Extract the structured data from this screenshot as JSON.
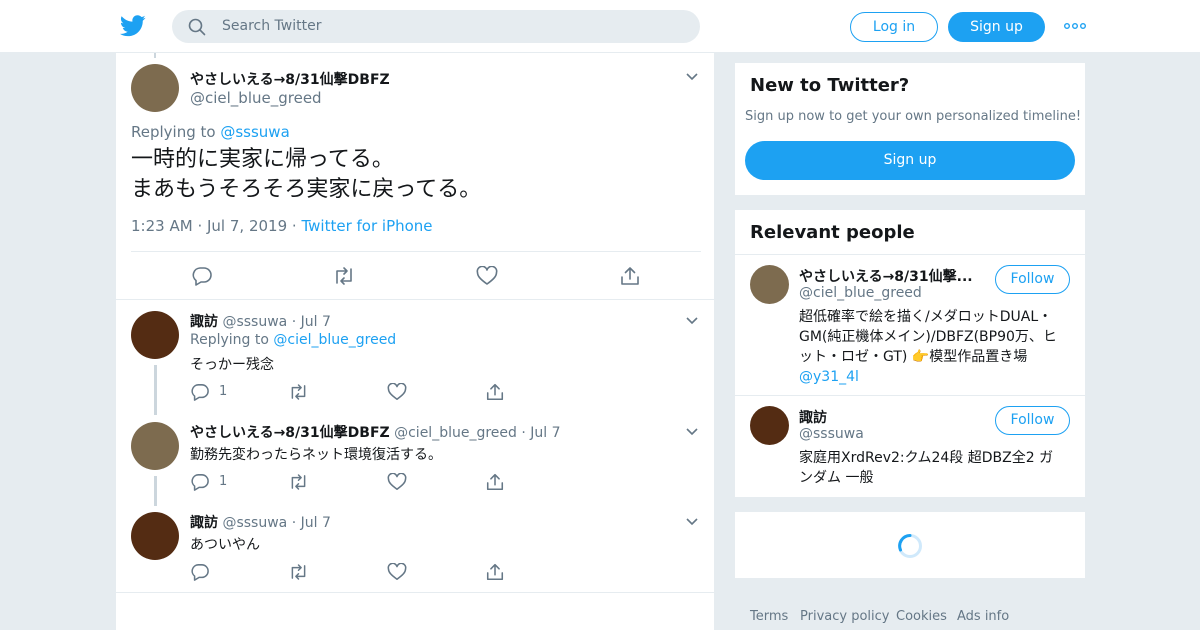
{
  "header": {
    "search_placeholder": "Search Twitter",
    "login_label": "Log in",
    "signup_label": "Sign up"
  },
  "main_tweet": {
    "name": "やさしいえる→8/31仙撃DBFZ",
    "handle": "@ciel_blue_greed",
    "replying_prefix": "Replying to",
    "replying_to": "@sssuwa",
    "text_line1": "一時的に実家に帰ってる。",
    "text_line2": "まあもうそろそろ実家に戻ってる。",
    "time": "1:23 AM",
    "date": "Jul 7, 2019",
    "source": "Twitter for iPhone"
  },
  "replies": [
    {
      "name": "諏訪",
      "handle": "@sssuwa",
      "date": "Jul 7",
      "replying_prefix": "Replying to",
      "replying_to": "@ciel_blue_greed",
      "text": "そっかー残念",
      "reply_count": "1"
    },
    {
      "name": "やさしいえる→8/31仙撃DBFZ",
      "handle": "@ciel_blue_greed",
      "date": "Jul 7",
      "text": "勤務先変わったらネット環境復活する。",
      "reply_count": "1"
    },
    {
      "name": "諏訪",
      "handle": "@sssuwa",
      "date": "Jul 7",
      "text": "あついやん"
    }
  ],
  "new_to_twitter": {
    "title": "New to Twitter?",
    "subtitle": "Sign up now to get your own personalized timeline!",
    "signup_label": "Sign up"
  },
  "relevant_people": {
    "title": "Relevant people",
    "people": [
      {
        "name": "やさしいえる→8/31仙撃...",
        "handle": "@ciel_blue_greed",
        "follow_label": "Follow",
        "bio_line1": "超低確率で絵を描く/メダロットDUAL・",
        "bio_line2": "GM(純正機体メイン)/DBFZ(BP90万、ヒ",
        "bio_line3": "ット・ロゼ・GT) 👉模型作品置き場",
        "bio_link": "@y31_4l"
      },
      {
        "name": "諏訪",
        "handle": "@sssuwa",
        "follow_label": "Follow",
        "bio_line1": "家庭用XrdRev2:クム24段 超DBZ全2 ガ",
        "bio_line2": "ンダム 一般"
      }
    ]
  },
  "footer": {
    "terms": "Terms",
    "privacy": "Privacy policy",
    "cookies": "Cookies",
    "ads": "Ads info"
  },
  "colors": {
    "accent": "#1da1f2",
    "background": "#e6ecf0",
    "muted": "#657786"
  }
}
